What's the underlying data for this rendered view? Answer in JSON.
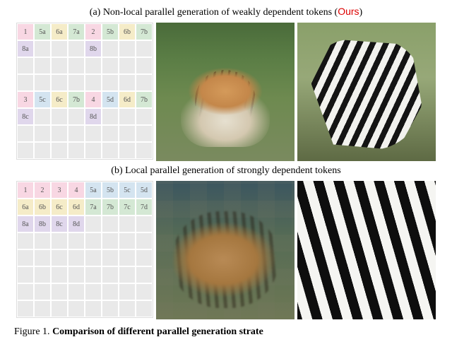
{
  "figure": {
    "label_a_prefix": "(a) Non-local parallel generation of weakly dependent tokens  (",
    "label_a_ours": "Ours",
    "label_a_suffix": ")",
    "label_b": "(b) Local parallel generation of strongly dependent tokens",
    "caption_prefix": "Figure 1.  ",
    "caption_bold_fragment": "Comparison of different parallel generation strate"
  },
  "grid_a": [
    [
      "1",
      "c-pink"
    ],
    [
      "5a",
      "c-green"
    ],
    [
      "6a",
      "c-yellow"
    ],
    [
      "7a",
      "c-green"
    ],
    [
      "2",
      "c-pink"
    ],
    [
      "5b",
      "c-green"
    ],
    [
      "6b",
      "c-yellow"
    ],
    [
      "7b",
      "c-green"
    ],
    [
      "8a",
      "c-purple"
    ],
    [
      "",
      "c-empty"
    ],
    [
      "",
      "c-empty"
    ],
    [
      "",
      "c-empty"
    ],
    [
      "8b",
      "c-purple"
    ],
    [
      "",
      "c-empty"
    ],
    [
      "",
      "c-empty"
    ],
    [
      "",
      "c-empty"
    ],
    [
      "",
      "c-empty"
    ],
    [
      "",
      "c-empty"
    ],
    [
      "",
      "c-empty"
    ],
    [
      "",
      "c-empty"
    ],
    [
      "",
      "c-empty"
    ],
    [
      "",
      "c-empty"
    ],
    [
      "",
      "c-empty"
    ],
    [
      "",
      "c-empty"
    ],
    [
      "",
      "c-empty"
    ],
    [
      "",
      "c-empty"
    ],
    [
      "",
      "c-empty"
    ],
    [
      "",
      "c-empty"
    ],
    [
      "",
      "c-empty"
    ],
    [
      "",
      "c-empty"
    ],
    [
      "",
      "c-empty"
    ],
    [
      "",
      "c-empty"
    ],
    [
      "3",
      "c-pink"
    ],
    [
      "5c",
      "c-blue"
    ],
    [
      "6c",
      "c-yellow"
    ],
    [
      "7b",
      "c-green"
    ],
    [
      "4",
      "c-pink"
    ],
    [
      "5d",
      "c-blue"
    ],
    [
      "6d",
      "c-yellow"
    ],
    [
      "7b",
      "c-green"
    ],
    [
      "8c",
      "c-purple"
    ],
    [
      "",
      "c-empty"
    ],
    [
      "",
      "c-empty"
    ],
    [
      "",
      "c-empty"
    ],
    [
      "8d",
      "c-purple"
    ],
    [
      "",
      "c-empty"
    ],
    [
      "",
      "c-empty"
    ],
    [
      "",
      "c-empty"
    ],
    [
      "",
      "c-empty"
    ],
    [
      "",
      "c-empty"
    ],
    [
      "",
      "c-empty"
    ],
    [
      "",
      "c-empty"
    ],
    [
      "",
      "c-empty"
    ],
    [
      "",
      "c-empty"
    ],
    [
      "",
      "c-empty"
    ],
    [
      "",
      "c-empty"
    ],
    [
      "",
      "c-empty"
    ],
    [
      "",
      "c-empty"
    ],
    [
      "",
      "c-empty"
    ],
    [
      "",
      "c-empty"
    ],
    [
      "",
      "c-empty"
    ],
    [
      "",
      "c-empty"
    ],
    [
      "",
      "c-empty"
    ],
    [
      "",
      "c-empty"
    ]
  ],
  "grid_b": [
    [
      "1",
      "c-pink"
    ],
    [
      "2",
      "c-pink"
    ],
    [
      "3",
      "c-pink"
    ],
    [
      "4",
      "c-pink"
    ],
    [
      "5a",
      "c-blue"
    ],
    [
      "5b",
      "c-blue"
    ],
    [
      "5c",
      "c-blue"
    ],
    [
      "5d",
      "c-blue"
    ],
    [
      "6a",
      "c-yellow"
    ],
    [
      "6b",
      "c-yellow"
    ],
    [
      "6c",
      "c-yellow"
    ],
    [
      "6d",
      "c-yellow"
    ],
    [
      "7a",
      "c-green"
    ],
    [
      "7b",
      "c-green"
    ],
    [
      "7c",
      "c-green"
    ],
    [
      "7d",
      "c-green"
    ],
    [
      "8a",
      "c-purple"
    ],
    [
      "8b",
      "c-purple"
    ],
    [
      "8c",
      "c-purple"
    ],
    [
      "8d",
      "c-purple"
    ],
    [
      "",
      "c-empty"
    ],
    [
      "",
      "c-empty"
    ],
    [
      "",
      "c-empty"
    ],
    [
      "",
      "c-empty"
    ],
    [
      "",
      "c-empty"
    ],
    [
      "",
      "c-empty"
    ],
    [
      "",
      "c-empty"
    ],
    [
      "",
      "c-empty"
    ],
    [
      "",
      "c-empty"
    ],
    [
      "",
      "c-empty"
    ],
    [
      "",
      "c-empty"
    ],
    [
      "",
      "c-empty"
    ],
    [
      "",
      "c-empty"
    ],
    [
      "",
      "c-empty"
    ],
    [
      "",
      "c-empty"
    ],
    [
      "",
      "c-empty"
    ],
    [
      "",
      "c-empty"
    ],
    [
      "",
      "c-empty"
    ],
    [
      "",
      "c-empty"
    ],
    [
      "",
      "c-empty"
    ],
    [
      "",
      "c-empty"
    ],
    [
      "",
      "c-empty"
    ],
    [
      "",
      "c-empty"
    ],
    [
      "",
      "c-empty"
    ],
    [
      "",
      "c-empty"
    ],
    [
      "",
      "c-empty"
    ],
    [
      "",
      "c-empty"
    ],
    [
      "",
      "c-empty"
    ],
    [
      "",
      "c-empty"
    ],
    [
      "",
      "c-empty"
    ],
    [
      "",
      "c-empty"
    ],
    [
      "",
      "c-empty"
    ],
    [
      "",
      "c-empty"
    ],
    [
      "",
      "c-empty"
    ],
    [
      "",
      "c-empty"
    ],
    [
      "",
      "c-empty"
    ],
    [
      "",
      "c-empty"
    ],
    [
      "",
      "c-empty"
    ],
    [
      "",
      "c-empty"
    ],
    [
      "",
      "c-empty"
    ],
    [
      "",
      "c-empty"
    ],
    [
      "",
      "c-empty"
    ],
    [
      "",
      "c-empty"
    ],
    [
      "",
      "c-empty"
    ]
  ]
}
